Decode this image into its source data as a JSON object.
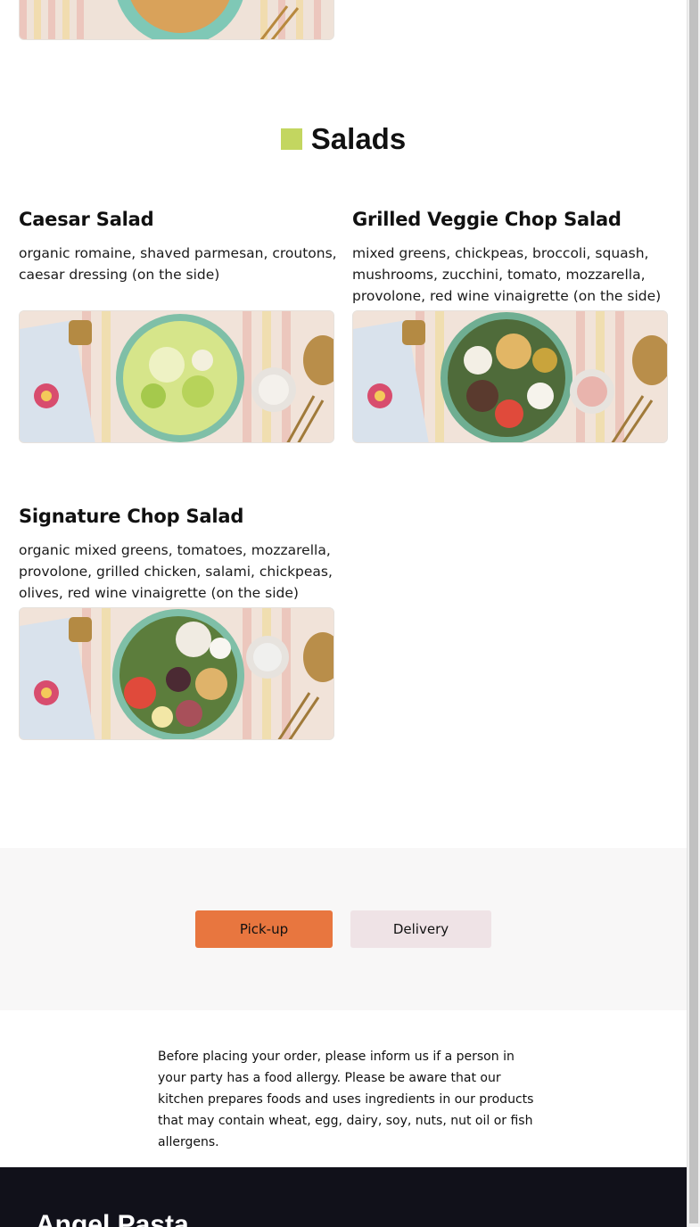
{
  "section": {
    "title": "Salads",
    "accent_color": "#c3d660"
  },
  "items": [
    {
      "title": "Caesar Salad",
      "description": "organic romaine, shaved parmesan, croutons, caesar dressing (on the side)",
      "image_alt": "Caesar Salad"
    },
    {
      "title": "Grilled Veggie Chop Salad",
      "description": "mixed greens, chickpeas, broccoli, squash, mushrooms, zucchini, tomato, mozzarella, provolone, red wine vinaigrette (on the side)",
      "image_alt": "Grilled Veggie Chop Salad"
    },
    {
      "title": "Signature Chop Salad",
      "description": "organic mixed greens, tomatoes, mozzarella, provolone, grilled chicken, salami, chickpeas, olives, red wine vinaigrette (on the side)",
      "image_alt": "Signature Chop Salad"
    }
  ],
  "order": {
    "pickup_label": "Pick-up",
    "delivery_label": "Delivery",
    "pickup_color": "#e8763f",
    "delivery_color": "#efe3e6"
  },
  "allergy_notice": "Before placing your order, please inform us if a person in your party has a food allergy. Please be aware that our kitchen prepares foods and uses ingredients in our products that may contain wheat, egg, dairy, soy, nuts, nut oil or fish allergens.",
  "footer": {
    "brand": "Angel Pasta"
  }
}
